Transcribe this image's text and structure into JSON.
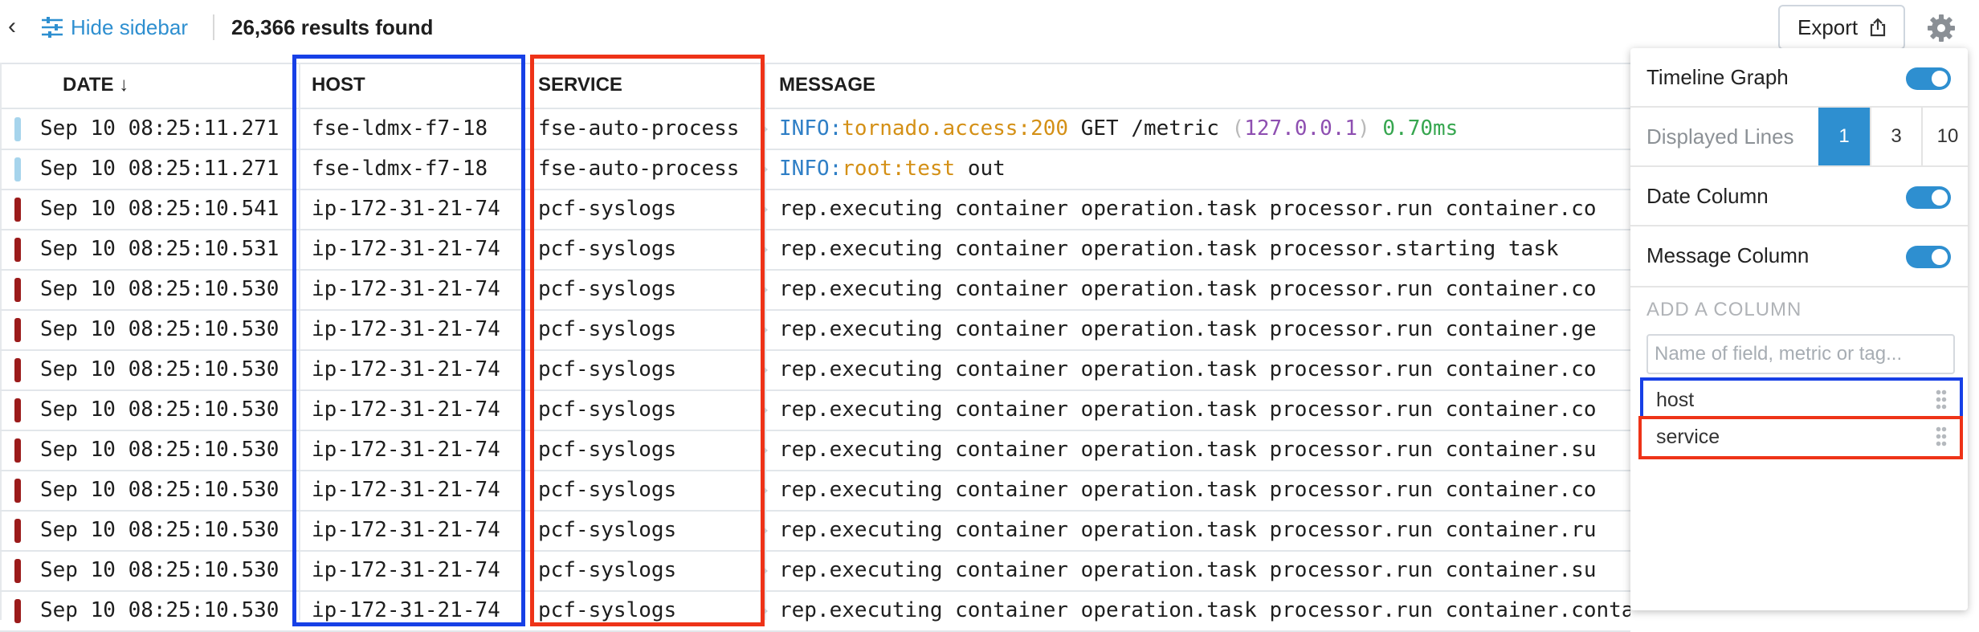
{
  "toolbar": {
    "hide_sidebar_label": "Hide sidebar",
    "results_text": "26,366 results found",
    "export_label": "Export"
  },
  "table": {
    "headers": {
      "date": "DATE",
      "date_sort": "↓",
      "host": "HOST",
      "service": "SERVICE",
      "message": "MESSAGE"
    },
    "rows": [
      {
        "status": "info",
        "date": "Sep 10 08:25:11.271",
        "host": "fse-ldmx-f7-18",
        "service": "fse-auto-process",
        "message": [
          [
            "INFO:",
            "blue"
          ],
          [
            "tornado.access:200",
            "orange"
          ],
          [
            " GET /metric ",
            ""
          ],
          [
            "(",
            "gray"
          ],
          [
            "127.0.0.1",
            "purple"
          ],
          [
            ") ",
            "gray"
          ],
          [
            "0.70ms",
            "green"
          ]
        ]
      },
      {
        "status": "info",
        "date": "Sep 10 08:25:11.271",
        "host": "fse-ldmx-f7-18",
        "service": "fse-auto-process",
        "message": [
          [
            "INFO:",
            "blue"
          ],
          [
            "root:test",
            "orange"
          ],
          [
            " out",
            ""
          ]
        ]
      },
      {
        "status": "error",
        "date": "Sep 10 08:25:10.541",
        "host": "ip-172-31-21-74",
        "service": "pcf-syslogs",
        "message": [
          [
            "rep.executing container operation.task processor.run container.co",
            ""
          ]
        ]
      },
      {
        "status": "error",
        "date": "Sep 10 08:25:10.531",
        "host": "ip-172-31-21-74",
        "service": "pcf-syslogs",
        "message": [
          [
            "rep.executing container operation.task processor.starting task",
            ""
          ]
        ]
      },
      {
        "status": "error",
        "date": "Sep 10 08:25:10.530",
        "host": "ip-172-31-21-74",
        "service": "pcf-syslogs",
        "message": [
          [
            "rep.executing container operation.task processor.run container.co",
            ""
          ]
        ]
      },
      {
        "status": "error",
        "date": "Sep 10 08:25:10.530",
        "host": "ip-172-31-21-74",
        "service": "pcf-syslogs",
        "message": [
          [
            "rep.executing container operation.task processor.run container.ge",
            ""
          ]
        ]
      },
      {
        "status": "error",
        "date": "Sep 10 08:25:10.530",
        "host": "ip-172-31-21-74",
        "service": "pcf-syslogs",
        "message": [
          [
            "rep.executing container operation.task processor.run container.co",
            ""
          ]
        ]
      },
      {
        "status": "error",
        "date": "Sep 10 08:25:10.530",
        "host": "ip-172-31-21-74",
        "service": "pcf-syslogs",
        "message": [
          [
            "rep.executing container operation.task processor.run container.co",
            ""
          ]
        ]
      },
      {
        "status": "error",
        "date": "Sep 10 08:25:10.530",
        "host": "ip-172-31-21-74",
        "service": "pcf-syslogs",
        "message": [
          [
            "rep.executing container operation.task processor.run container.su",
            ""
          ]
        ]
      },
      {
        "status": "error",
        "date": "Sep 10 08:25:10.530",
        "host": "ip-172-31-21-74",
        "service": "pcf-syslogs",
        "message": [
          [
            "rep.executing container operation.task processor.run container.co",
            ""
          ]
        ]
      },
      {
        "status": "error",
        "date": "Sep 10 08:25:10.530",
        "host": "ip-172-31-21-74",
        "service": "pcf-syslogs",
        "message": [
          [
            "rep.executing container operation.task processor.run container.ru",
            ""
          ]
        ]
      },
      {
        "status": "error",
        "date": "Sep 10 08:25:10.530",
        "host": "ip-172-31-21-74",
        "service": "pcf-syslogs",
        "message": [
          [
            "rep.executing container operation.task processor.run container.su",
            ""
          ]
        ]
      },
      {
        "status": "error",
        "date": "Sep 10 08:25:10.530",
        "host": "ip-172-31-21-74",
        "service": "pcf-syslogs",
        "message": [
          [
            "rep.executing container operation.task processor.run container.containerstore create.node",
            ""
          ]
        ]
      }
    ]
  },
  "settings": {
    "timeline_graph_label": "Timeline Graph",
    "displayed_lines_label": "Displayed Lines",
    "displayed_lines_options": [
      "1",
      "3",
      "10"
    ],
    "displayed_lines_selected": "1",
    "date_column_label": "Date Column",
    "message_column_label": "Message Column",
    "add_column_title": "ADD A COLUMN",
    "add_column_placeholder": "Name of field, metric or tag...",
    "columns": [
      "host",
      "service"
    ]
  },
  "colors": {
    "accent": "#2e8fd0",
    "status_info": "#a6d4ec",
    "status_error": "#9b1b1b",
    "highlight_host": "#1740e6",
    "highlight_service": "#ee3318"
  },
  "icons": [
    "chevron-left-icon",
    "sliders-icon",
    "export-icon",
    "gear-icon",
    "drag-handle-icon"
  ]
}
